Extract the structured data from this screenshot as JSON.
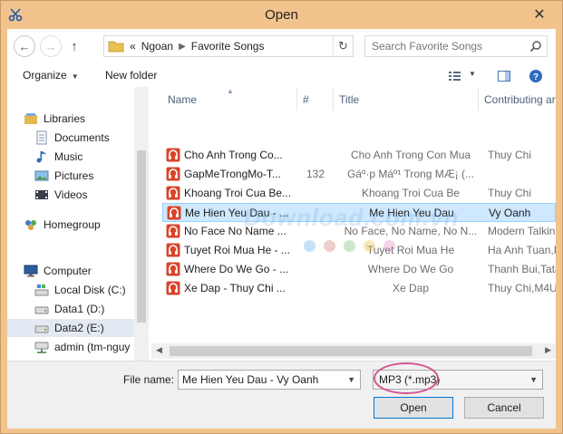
{
  "window": {
    "title": "Open"
  },
  "address": {
    "breadcrumb": [
      "«",
      "Ngoan",
      "Favorite Songs"
    ]
  },
  "search": {
    "placeholder": "Search Favorite Songs"
  },
  "toolbar": {
    "organize": "Organize",
    "new_folder": "New folder"
  },
  "navpane": {
    "libraries": "Libraries",
    "documents": "Documents",
    "music": "Music",
    "pictures": "Pictures",
    "videos": "Videos",
    "homegroup": "Homegroup",
    "computer": "Computer",
    "local_disk": "Local Disk (C:)",
    "data1": "Data1 (D:)",
    "data2": "Data2 (E:)",
    "network": "admin (tm-nguy"
  },
  "columns": {
    "name": "Name",
    "num": "#",
    "title": "Title",
    "artist": "Contributing art"
  },
  "files": [
    {
      "name": "Cho Anh Trong Co...",
      "num": "",
      "title": "Cho Anh Trong Con Mua",
      "artist": "Thuy Chi"
    },
    {
      "name": "GapMeTrongMo-T...",
      "num": "132",
      "title": "Gáº·p Máº¹ Trong MÆ¡ (...",
      "artist": ""
    },
    {
      "name": "Khoang Troi Cua Be...",
      "num": "",
      "title": "Khoang Troi Cua Be",
      "artist": "Thuy Chi"
    },
    {
      "name": "Me Hien Yeu Dau - ...",
      "num": "",
      "title": "Me Hien Yeu Dau",
      "artist": "Vy Oanh"
    },
    {
      "name": "No Face No Name ...",
      "num": "",
      "title": "No Face, No Name, No N...",
      "artist": "Modern Talking"
    },
    {
      "name": "Tuyet Roi Mua He - ...",
      "num": "",
      "title": "Tuyet Roi Mua He",
      "artist": "Ha Anh Tuan,Ph"
    },
    {
      "name": "Where Do We Go - ...",
      "num": "",
      "title": "Where Do We Go",
      "artist": "Thanh Bui,Tata"
    },
    {
      "name": "Xe Dap - Thuy Chi ...",
      "num": "",
      "title": "Xe Dap",
      "artist": "Thuy Chi,M4U"
    }
  ],
  "selected_index": 3,
  "footer": {
    "file_name_label": "File name:",
    "file_name_value": "Me Hien Yeu Dau - Vy Oanh",
    "file_type": "MP3 (*.mp3)",
    "open": "Open",
    "cancel": "Cancel"
  },
  "watermark": "Download.com.vn",
  "colors": {
    "frame": "#f2c38d",
    "selection": "#cde8ff",
    "music_icon": "#d9442a",
    "highlight_circle": "#d55490"
  }
}
